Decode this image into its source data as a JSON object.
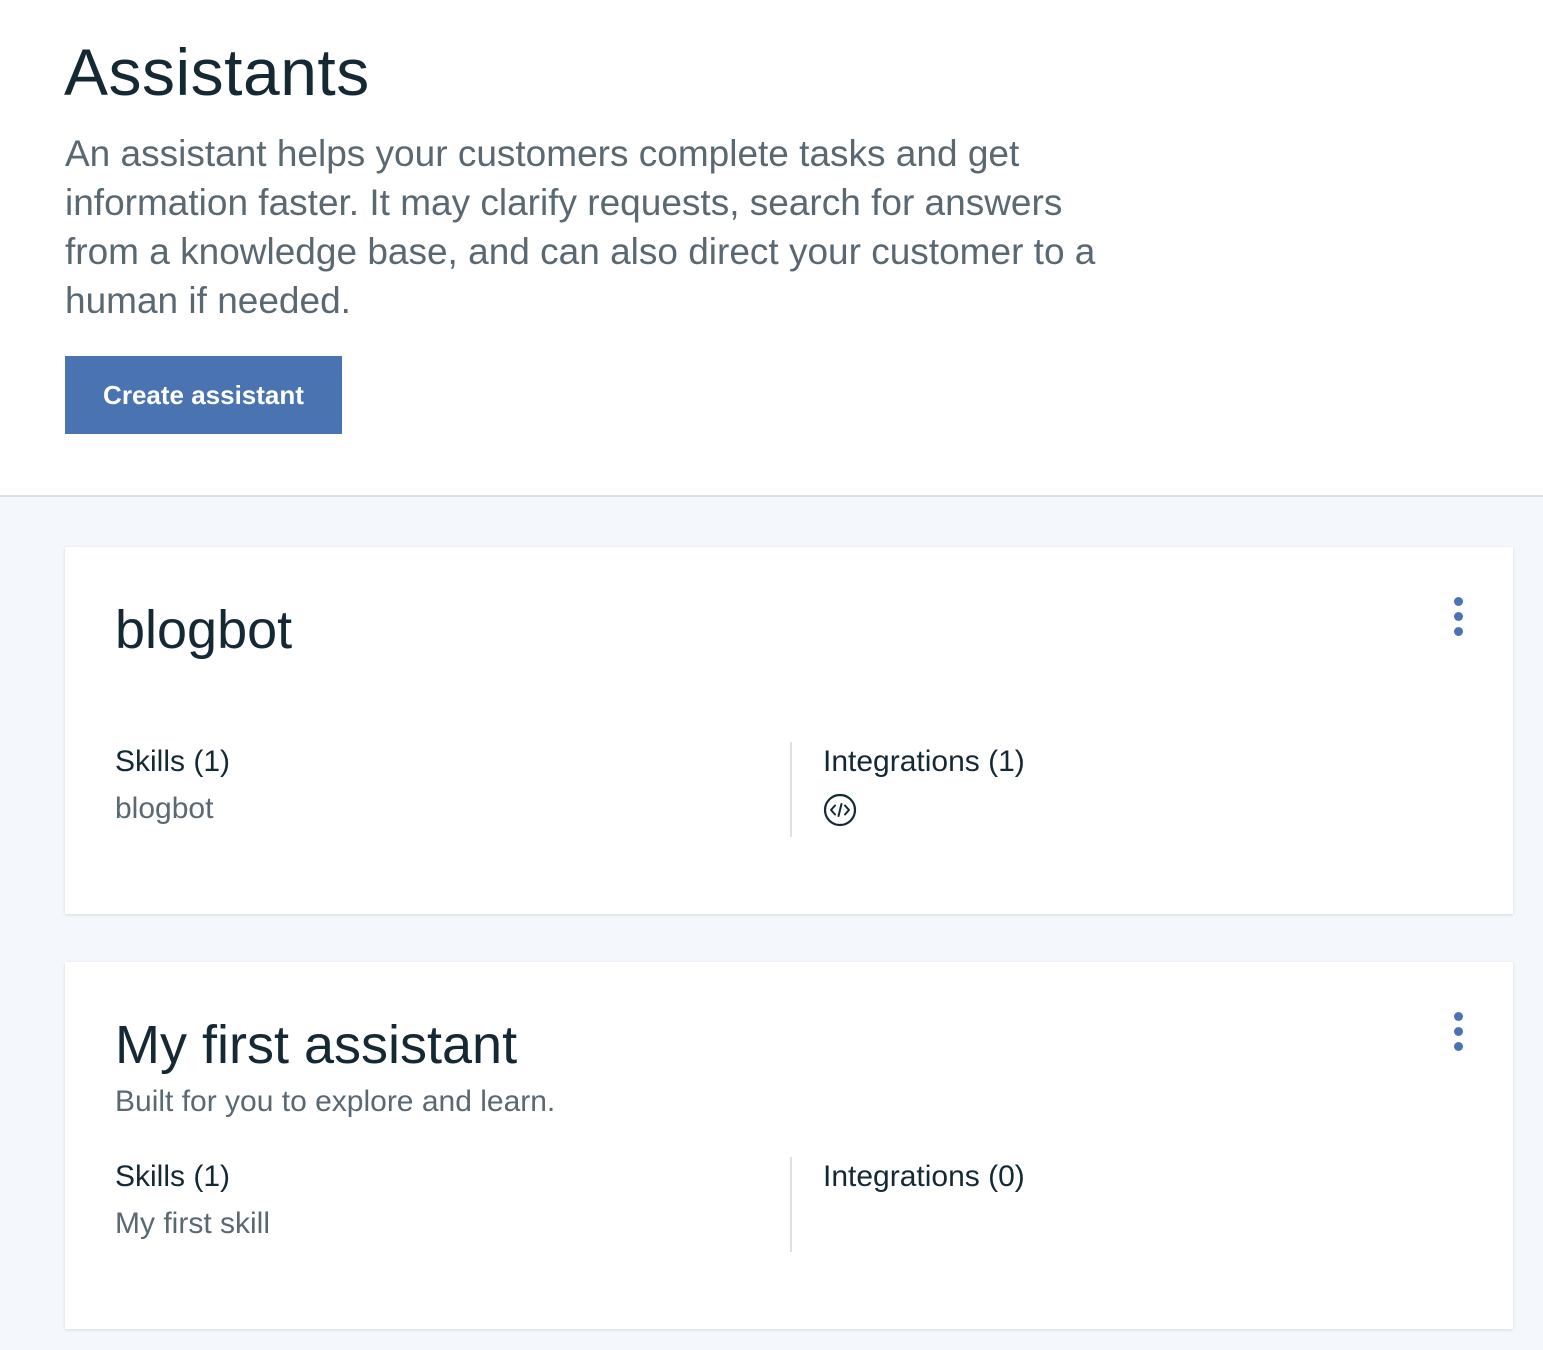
{
  "header": {
    "title": "Assistants",
    "description": "An assistant helps your customers complete tasks and get information faster. It may clarify requests, search for answers from a knowledge base, and can also direct your customer to a human if needed.",
    "create_button_label": "Create assistant"
  },
  "assistants": [
    {
      "name": "blogbot",
      "subtitle": "",
      "skills_label": "Skills (1)",
      "skills_value": "blogbot",
      "integrations_label": "Integrations (1)",
      "integration_icons": [
        "web-chat-embed-icon"
      ]
    },
    {
      "name": "My first assistant",
      "subtitle": "Built for you to explore and learn.",
      "skills_label": "Skills (1)",
      "skills_value": "My first skill",
      "integrations_label": "Integrations (0)",
      "integration_icons": []
    }
  ],
  "colors": {
    "primary_button": "#4a73b2",
    "title_text": "#152935",
    "secondary_text": "#5a6872",
    "list_background": "#f4f7fb"
  }
}
